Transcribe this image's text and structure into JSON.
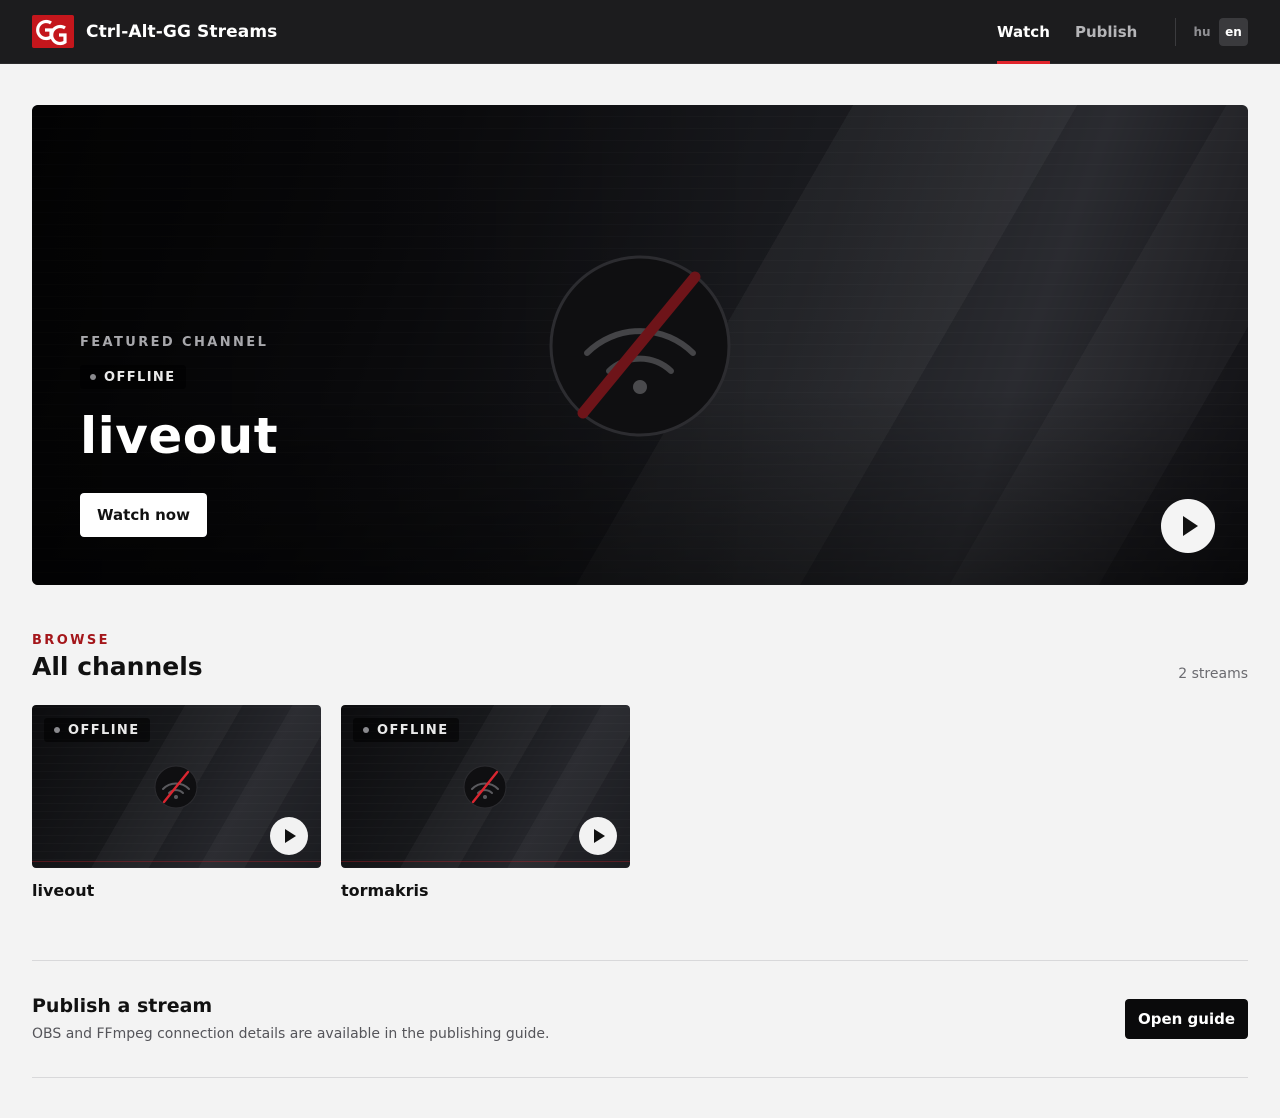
{
  "header": {
    "brand_title": "Ctrl-Alt-GG Streams",
    "nav": {
      "watch": "Watch",
      "publish": "Publish"
    },
    "languages": {
      "hu": "hu",
      "en": "en",
      "active": "en"
    },
    "logo_icon": "gg-logo",
    "accent_color": "#e0242b"
  },
  "hero": {
    "eyebrow": "FEATURED CHANNEL",
    "status": "OFFLINE",
    "title": "liveout",
    "watch_button": "Watch now",
    "graphic_icon": "signal-off-icon",
    "play_icon": "play-icon"
  },
  "browse": {
    "eyebrow": "BROWSE",
    "title": "All channels",
    "count": "2 streams",
    "channels": [
      {
        "name": "liveout",
        "status": "OFFLINE"
      },
      {
        "name": "tormakris",
        "status": "OFFLINE"
      }
    ]
  },
  "publish": {
    "title": "Publish a stream",
    "description": "OBS and FFmpeg connection details are available in the publishing guide.",
    "button": "Open guide"
  }
}
